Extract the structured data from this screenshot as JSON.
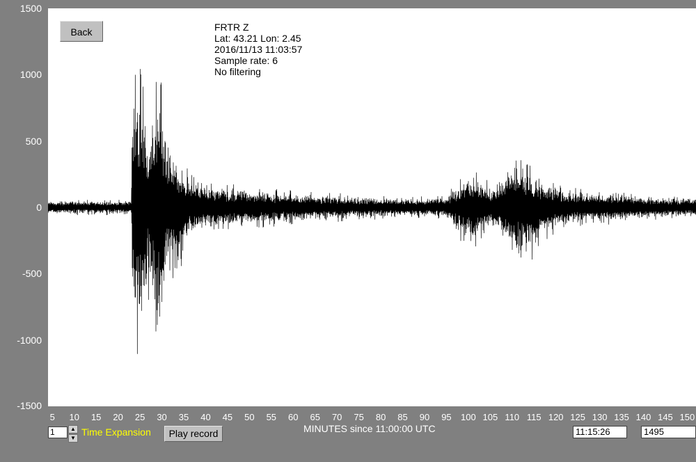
{
  "toolbar": {
    "back_label": "Back",
    "play_label": "Play record",
    "time_expansion_label": "Time Expansion",
    "time_expansion_value": "1"
  },
  "station": {
    "name": "FRTR  Z",
    "location": "Lat: 43.21 Lon: 2.45",
    "datetime": "2016/11/13 11:03:57",
    "sample_rate": "Sample rate: 6",
    "filter": "No filtering"
  },
  "status": {
    "time": "11:15:26",
    "count": "1495"
  },
  "colors": {
    "background": "#808080",
    "plot": "#ffffff",
    "trace": "#000000",
    "axis_text": "#ffffff",
    "accent": "#ffff00"
  },
  "chart_data": {
    "type": "line",
    "xlabel": "MINUTES since 11:00:00 UTC",
    "ylabel": "",
    "title": "",
    "xlim": [
      4,
      152
    ],
    "ylim": [
      -1500,
      1500
    ],
    "y_ticks": [
      1500,
      1000,
      500,
      0,
      -500,
      -1000,
      -1500
    ],
    "y_tick_labels": [
      "1500",
      "1000",
      "500",
      "0",
      "-500",
      "-1000",
      "-1500"
    ],
    "x_ticks": [
      5,
      10,
      15,
      20,
      25,
      30,
      35,
      40,
      45,
      50,
      55,
      60,
      65,
      70,
      75,
      80,
      85,
      90,
      95,
      100,
      105,
      110,
      115,
      120,
      125,
      130,
      135,
      140,
      145,
      150
    ],
    "grid": false,
    "envelope": [
      [
        4,
        60,
        -60
      ],
      [
        20,
        60,
        -60
      ],
      [
        23,
        60,
        -60
      ],
      [
        23.3,
        950,
        -1120
      ],
      [
        25,
        1220,
        -1150
      ],
      [
        27,
        800,
        -700
      ],
      [
        29.5,
        1120,
        -1230
      ],
      [
        31,
        600,
        -600
      ],
      [
        33,
        550,
        -650
      ],
      [
        35,
        350,
        -400
      ],
      [
        37,
        250,
        -250
      ],
      [
        40,
        200,
        -220
      ],
      [
        45,
        180,
        -180
      ],
      [
        50,
        160,
        -160
      ],
      [
        55,
        150,
        -150
      ],
      [
        60,
        130,
        -130
      ],
      [
        65,
        120,
        -120
      ],
      [
        70,
        110,
        -110
      ],
      [
        75,
        100,
        -100
      ],
      [
        80,
        90,
        -90
      ],
      [
        85,
        85,
        -85
      ],
      [
        90,
        85,
        -85
      ],
      [
        95,
        100,
        -100
      ],
      [
        100,
        300,
        -350
      ],
      [
        103,
        250,
        -250
      ],
      [
        106,
        200,
        -200
      ],
      [
        109,
        350,
        -350
      ],
      [
        111,
        420,
        -490
      ],
      [
        113,
        450,
        -520
      ],
      [
        116,
        250,
        -300
      ],
      [
        120,
        200,
        -200
      ],
      [
        125,
        150,
        -150
      ],
      [
        130,
        140,
        -140
      ],
      [
        135,
        120,
        -120
      ],
      [
        140,
        100,
        -100
      ],
      [
        145,
        90,
        -90
      ],
      [
        150,
        90,
        -90
      ],
      [
        152,
        90,
        -90
      ]
    ]
  }
}
